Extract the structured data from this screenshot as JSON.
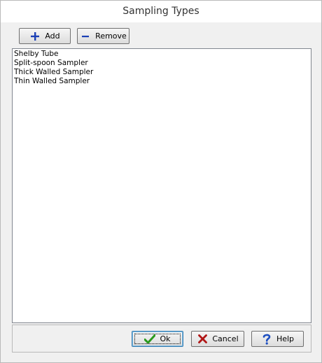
{
  "window": {
    "title": "Sampling Types"
  },
  "toolbar": {
    "add_label": "Add",
    "remove_label": "Remove"
  },
  "list": {
    "items": [
      {
        "label": "Shelby Tube"
      },
      {
        "label": "Split-spoon Sampler"
      },
      {
        "label": "Thick Walled Sampler"
      },
      {
        "label": "Thin Walled Sampler"
      }
    ]
  },
  "footer": {
    "ok_label": "Ok",
    "cancel_label": "Cancel",
    "help_label": "Help"
  },
  "colors": {
    "add_icon": "#1a3fb5",
    "ok_icon": "#2a9a1e",
    "cancel_icon": "#b01616",
    "help_icon": "#1e4fc0"
  },
  "icons": {
    "add": "plus-icon",
    "remove": "minus-icon",
    "ok": "checkmark-icon",
    "cancel": "x-icon",
    "help": "question-icon"
  }
}
